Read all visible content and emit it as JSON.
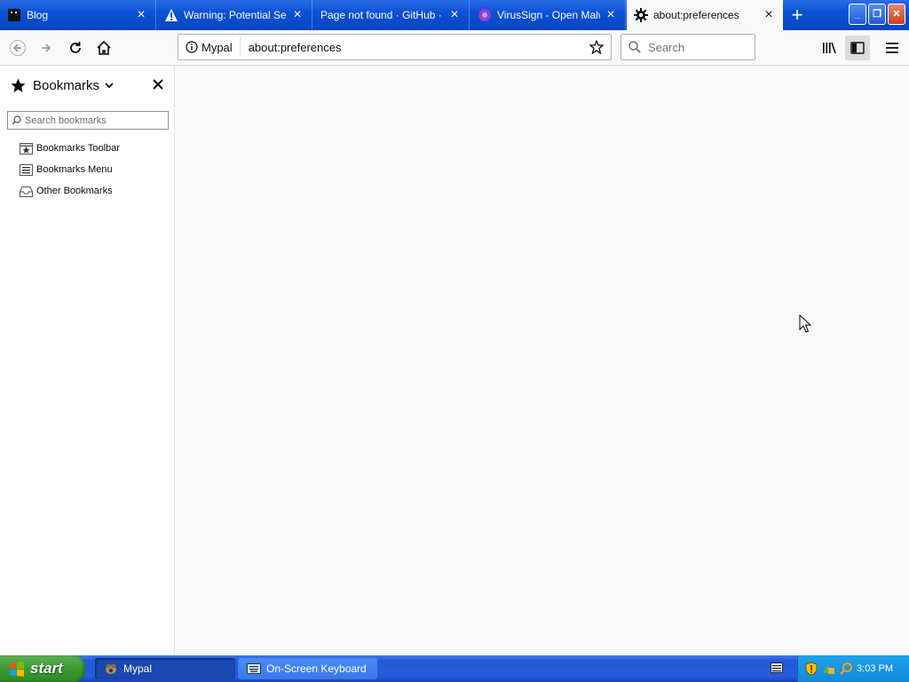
{
  "tabs": [
    {
      "title": "Blog",
      "icon": "blog-favicon-icon",
      "active": false
    },
    {
      "title": "Warning: Potential Secu",
      "icon": "warning-icon",
      "active": false
    },
    {
      "title": "Page not found · GitHub · Gi",
      "icon": "",
      "active": false
    },
    {
      "title": "VirusSign - Open Malwa",
      "icon": "virussign-favicon-icon",
      "active": false
    },
    {
      "title": "about:preferences",
      "icon": "gear-icon",
      "active": true
    }
  ],
  "navbar": {
    "identity_label": "Mypal",
    "url": "about:preferences",
    "search_placeholder": "Search"
  },
  "sidebar": {
    "title": "Bookmarks",
    "search_placeholder": "Search bookmarks",
    "items": [
      {
        "label": "Bookmarks Toolbar",
        "icon": "bookmarks-toolbar-icon"
      },
      {
        "label": "Bookmarks Menu",
        "icon": "bookmarks-menu-icon"
      },
      {
        "label": "Other Bookmarks",
        "icon": "other-bookmarks-icon"
      }
    ]
  },
  "taskbar": {
    "start_label": "start",
    "tasks": [
      {
        "label": "Mypal",
        "icon": "mypal-icon",
        "active": true
      },
      {
        "label": "On-Screen Keyboard",
        "icon": "keyboard-icon",
        "active": false
      }
    ],
    "clock": "3:03 PM"
  },
  "colors": {
    "tabstrip": "#0b52d6",
    "active_tab": "#f9f9fa",
    "content_bg": "#f9f9fa",
    "start_green": "#3c9b33",
    "taskbar_blue": "#245ddb",
    "tray_blue": "#138ad9"
  }
}
